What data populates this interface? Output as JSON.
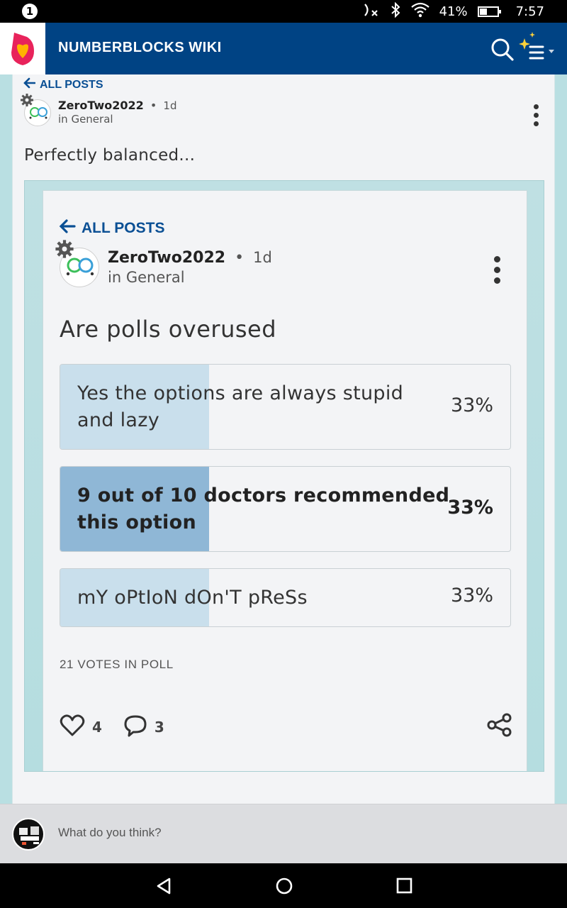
{
  "status_bar": {
    "notification_count": "1",
    "battery_percent": "41%",
    "battery_level": 0.41,
    "time": "7:57",
    "icons": [
      "notification-badge-icon",
      "nfc-off-icon",
      "bluetooth-icon",
      "wifi-icon",
      "battery-icon"
    ]
  },
  "app_bar": {
    "title": "NUMBERBLOCKS WIKI",
    "logo_icon": "community-logo-icon",
    "search_icon": "search-icon",
    "menu_icon": "sparkle-menu-icon"
  },
  "post": {
    "back_label": "ALL POSTS",
    "author": "ZeroTwo2022",
    "separator": "•",
    "time": "1d",
    "community": "in General",
    "text": "Perfectly balanced..."
  },
  "embedded": {
    "back_label": "ALL POSTS",
    "author": "ZeroTwo2022",
    "separator": "•",
    "time": "1d",
    "community": "in General",
    "title": "Are polls overused",
    "poll": {
      "options": [
        {
          "line1": "Yes the options are always stupid",
          "line2": "and lazy",
          "percent": "33%",
          "share": 0.33,
          "selected": false
        },
        {
          "line1": "9 out of 10 doctors recommended",
          "line2": "this option",
          "percent": "33%",
          "share": 0.33,
          "selected": true
        },
        {
          "line1": "mY oPtIoN dOn'T pReSs",
          "line2": "",
          "percent": "33%",
          "share": 0.33,
          "selected": false
        }
      ],
      "votes_label": "21 VOTES IN POLL"
    },
    "likes": "4",
    "comments": "3"
  },
  "comment_bar": {
    "placeholder": "What do you think?"
  },
  "nav_bar": {
    "icons": [
      "back-triangle-icon",
      "home-circle-icon",
      "recents-square-icon"
    ]
  },
  "colors": {
    "app_bar": "#004384",
    "link": "#0a4f94",
    "poll_fill": "#c9dfec",
    "poll_fill_selected": "#8fb7d6"
  }
}
